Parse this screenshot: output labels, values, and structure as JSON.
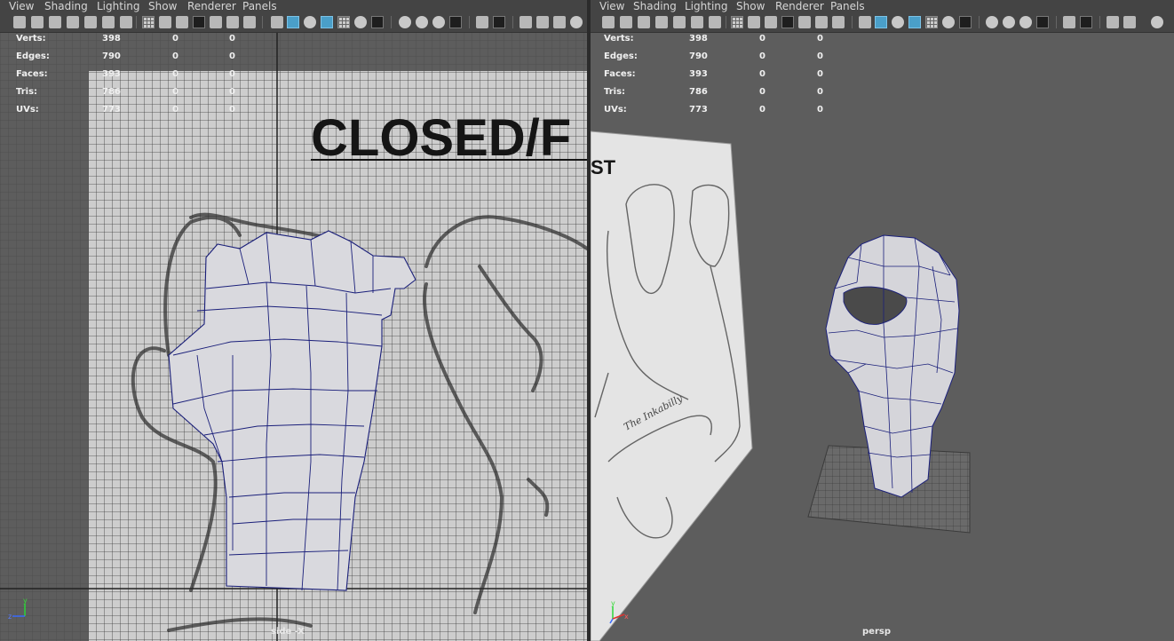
{
  "menu": [
    "View",
    "Shading",
    "Lighting",
    "Show",
    "Renderer",
    "Panels"
  ],
  "stats": [
    {
      "label": "Verts:",
      "a": "398",
      "b": "0",
      "c": "0"
    },
    {
      "label": "Edges:",
      "a": "790",
      "b": "0",
      "c": "0"
    },
    {
      "label": "Faces:",
      "a": "393",
      "b": "0",
      "c": "0"
    },
    {
      "label": "Tris:",
      "a": "786",
      "b": "0",
      "c": "0"
    },
    {
      "label": "UVs:",
      "a": "773",
      "b": "0",
      "c": "0"
    }
  ],
  "left_viewport": {
    "camera": "side -X",
    "sign_text": "CLOSED/F"
  },
  "right_viewport": {
    "camera": "persp",
    "sign_text": "ST",
    "signature": "The Inkabilly"
  },
  "colors": {
    "viewport_bg": "#5d5d5d",
    "wireframe": "#1a1f7a",
    "accent": "#4a9fc9"
  },
  "icons": [
    "camera-select-icon",
    "bookmark-icon",
    "grid-icon",
    "wireframe-icon",
    "smooth-shade-icon",
    "light-icon",
    "isolate-icon",
    "render-icon"
  ]
}
